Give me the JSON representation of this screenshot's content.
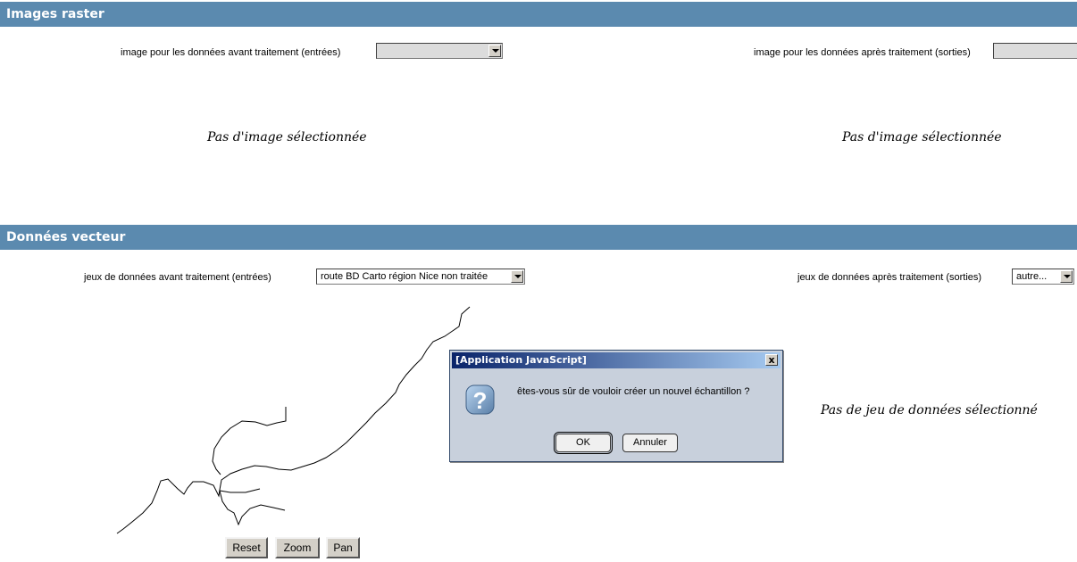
{
  "raster": {
    "title": "Images raster",
    "input_label": "image pour les données avant traitement (entrées)",
    "input_value": "",
    "output_label": "image pour les données après traitement (sorties)",
    "output_value": "",
    "input_placeholder": "Pas d'image sélectionnée",
    "output_placeholder": "Pas d'image sélectionnée"
  },
  "vector": {
    "title": "Données vecteur",
    "input_label": "jeux de données avant traitement (entrées)",
    "input_value": "route BD Carto région Nice non traitée",
    "output_label": "jeux de données après traitement (sorties)",
    "output_value": "autre...",
    "output_placeholder": "Pas de jeu de données sélectionné"
  },
  "map": {
    "reset_label": "Reset",
    "zoom_label": "Zoom",
    "pan_label": "Pan"
  },
  "dialog": {
    "title": "[Application JavaScript]",
    "close_label": "x",
    "message": "êtes-vous sûr de vouloir créer un nouvel échantillon ?",
    "ok_label": "OK",
    "cancel_label": "Annuler",
    "icon": "question-icon"
  },
  "colors": {
    "header_bg": "#5b8aaf",
    "dialog_bg": "#c8d0dc",
    "title_bar": "#0a246a"
  }
}
